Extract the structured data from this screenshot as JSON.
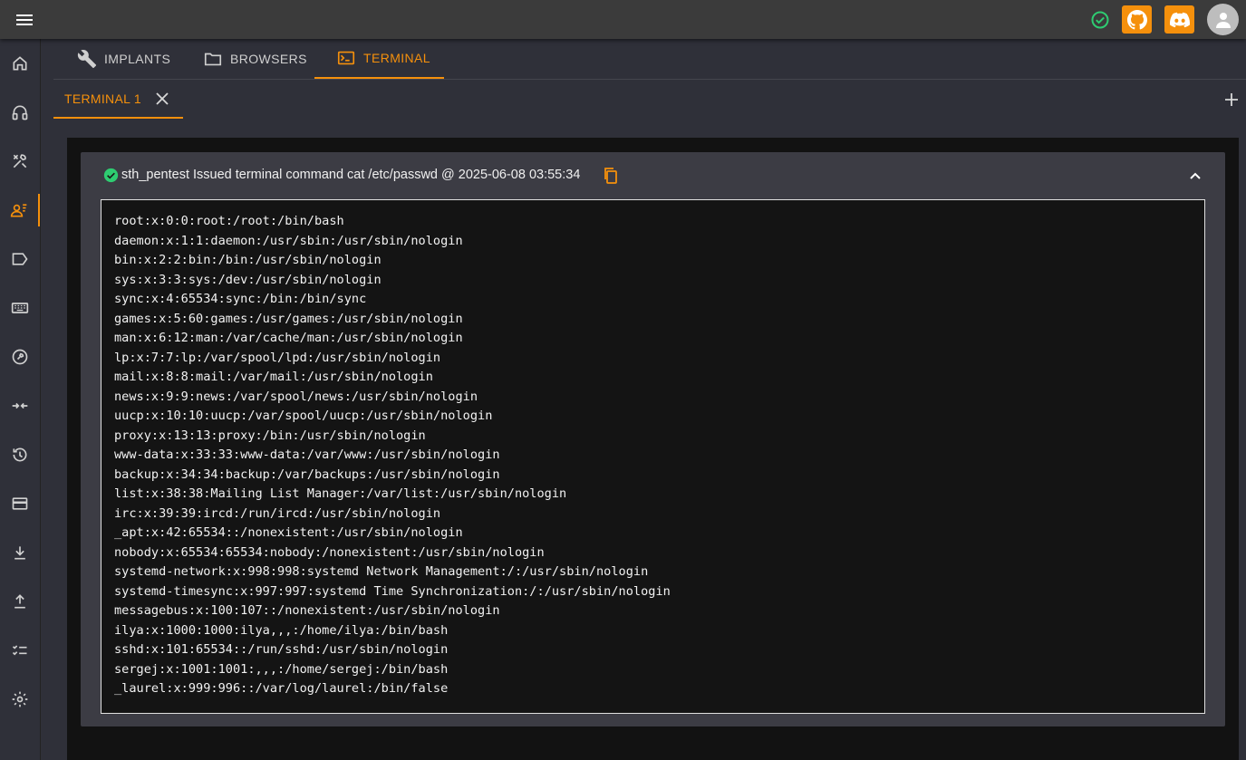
{
  "topbar": {
    "menu_icon": "hamburger-menu-icon",
    "status_icon": "check-circle-icon",
    "github_icon": "github-icon",
    "discord_icon": "discord-icon",
    "avatar_icon": "user-avatar-icon",
    "accent": "#f5900c",
    "status_color": "#2ecc71"
  },
  "sidebar": {
    "items": [
      {
        "icon": "home-icon"
      },
      {
        "icon": "headphones-icon"
      },
      {
        "icon": "tools-icon"
      },
      {
        "icon": "operator-icon",
        "active": true
      },
      {
        "icon": "label-icon"
      },
      {
        "icon": "keyboard-icon"
      },
      {
        "icon": "wrench-circle-icon"
      },
      {
        "icon": "compress-arrows-icon"
      },
      {
        "icon": "history-icon"
      },
      {
        "icon": "card-icon"
      },
      {
        "icon": "download-icon"
      },
      {
        "icon": "upload-icon"
      },
      {
        "icon": "checklist-icon"
      },
      {
        "icon": "settings-gear-icon"
      }
    ]
  },
  "tabs": [
    {
      "label": "IMPLANTS",
      "icon": "wrench-icon"
    },
    {
      "label": "BROWSERS",
      "icon": "folder-icon"
    },
    {
      "label": "TERMINAL",
      "icon": "terminal-icon",
      "active": true
    }
  ],
  "terminal_tabs": {
    "tab_label": "TERMINAL 1",
    "close_icon": "close-icon",
    "add_icon": "plus-icon"
  },
  "entry": {
    "status_icon": "check-circle-icon",
    "header": "sth_pentest Issued terminal command cat /etc/passwd @ 2025-06-08 03:55:34",
    "copy_icon": "copy-icon",
    "collapse_icon": "chevron-up-icon",
    "output": "root:x:0:0:root:/root:/bin/bash\ndaemon:x:1:1:daemon:/usr/sbin:/usr/sbin/nologin\nbin:x:2:2:bin:/bin:/usr/sbin/nologin\nsys:x:3:3:sys:/dev:/usr/sbin/nologin\nsync:x:4:65534:sync:/bin:/bin/sync\ngames:x:5:60:games:/usr/games:/usr/sbin/nologin\nman:x:6:12:man:/var/cache/man:/usr/sbin/nologin\nlp:x:7:7:lp:/var/spool/lpd:/usr/sbin/nologin\nmail:x:8:8:mail:/var/mail:/usr/sbin/nologin\nnews:x:9:9:news:/var/spool/news:/usr/sbin/nologin\nuucp:x:10:10:uucp:/var/spool/uucp:/usr/sbin/nologin\nproxy:x:13:13:proxy:/bin:/usr/sbin/nologin\nwww-data:x:33:33:www-data:/var/www:/usr/sbin/nologin\nbackup:x:34:34:backup:/var/backups:/usr/sbin/nologin\nlist:x:38:38:Mailing List Manager:/var/list:/usr/sbin/nologin\nirc:x:39:39:ircd:/run/ircd:/usr/sbin/nologin\n_apt:x:42:65534::/nonexistent:/usr/sbin/nologin\nnobody:x:65534:65534:nobody:/nonexistent:/usr/sbin/nologin\nsystemd-network:x:998:998:systemd Network Management:/:/usr/sbin/nologin\nsystemd-timesync:x:997:997:systemd Time Synchronization:/:/usr/sbin/nologin\nmessagebus:x:100:107::/nonexistent:/usr/sbin/nologin\nilya:x:1000:1000:ilya,,,:/home/ilya:/bin/bash\nsshd:x:101:65534::/run/sshd:/usr/sbin/nologin\nsergej:x:1001:1001:,,,:/home/sergej:/bin/bash\n_laurel:x:999:996::/var/log/laurel:/bin/false"
  }
}
